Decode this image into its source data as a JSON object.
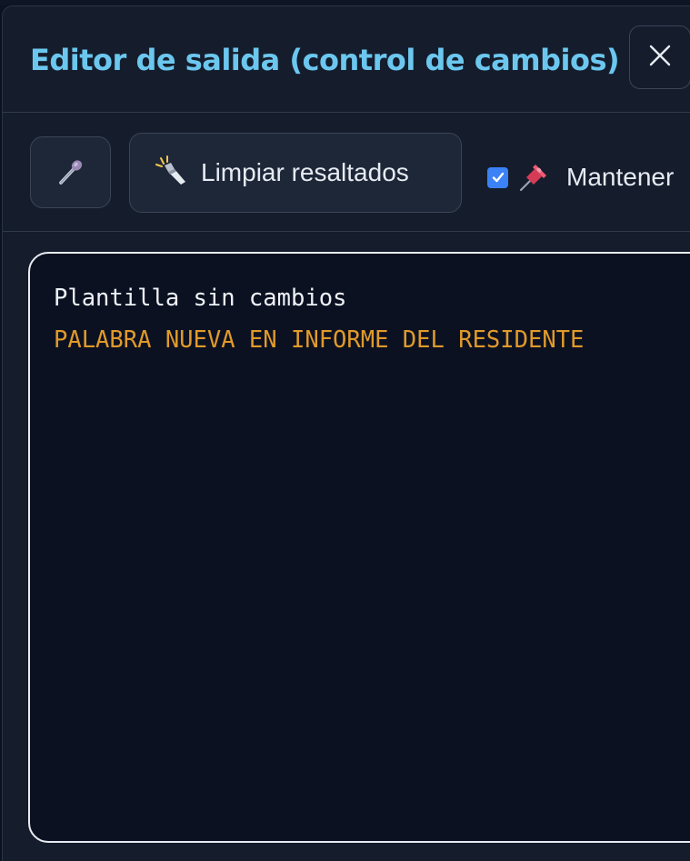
{
  "modal": {
    "title": "Editor de salida (control de cambios)",
    "close_icon": "close-icon"
  },
  "toolbar": {
    "mic_icon": "microphone-icon",
    "clear_button": {
      "icon": "flashlight-icon",
      "label": "Limpiar resaltados"
    },
    "keep": {
      "checked": true,
      "icon": "pushpin-icon",
      "label": "Mantener"
    }
  },
  "editor": {
    "lines": [
      {
        "text": "Plantilla sin cambios",
        "status": "unchanged",
        "color": "#eef1f6"
      },
      {
        "text": "PALABRA NUEVA EN INFORME DEL RESIDENTE",
        "status": "new",
        "color": "#e09a2a"
      }
    ]
  },
  "colors": {
    "title_accent": "#6cc7ef",
    "modal_bg": "#151d2c",
    "editor_bg": "#0c1122",
    "highlight_new": "#e09a2a",
    "checkbox": "#3b82f6"
  }
}
